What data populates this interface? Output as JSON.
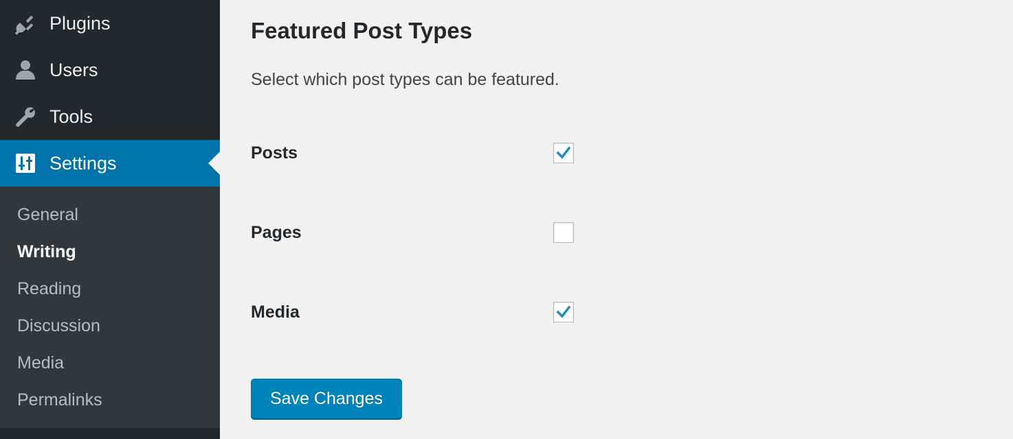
{
  "sidebar": {
    "menu": [
      {
        "label": "Plugins",
        "icon": "plug-icon"
      },
      {
        "label": "Users",
        "icon": "user-icon"
      },
      {
        "label": "Tools",
        "icon": "wrench-icon"
      },
      {
        "label": "Settings",
        "icon": "settings-icon",
        "active": true
      }
    ],
    "submenu": [
      {
        "label": "General"
      },
      {
        "label": "Writing",
        "current": true
      },
      {
        "label": "Reading"
      },
      {
        "label": "Discussion"
      },
      {
        "label": "Media"
      },
      {
        "label": "Permalinks"
      }
    ]
  },
  "main": {
    "title": "Featured Post Types",
    "description": "Select which post types can be featured.",
    "options": [
      {
        "label": "Posts",
        "checked": true
      },
      {
        "label": "Pages",
        "checked": false
      },
      {
        "label": "Media",
        "checked": true
      }
    ],
    "save_label": "Save Changes"
  },
  "colors": {
    "sidebar_bg": "#23282d",
    "submenu_bg": "#32373c",
    "accent": "#0073aa",
    "button": "#0085ba",
    "check": "#1e8cbe",
    "page_bg": "#f1f1f1"
  }
}
